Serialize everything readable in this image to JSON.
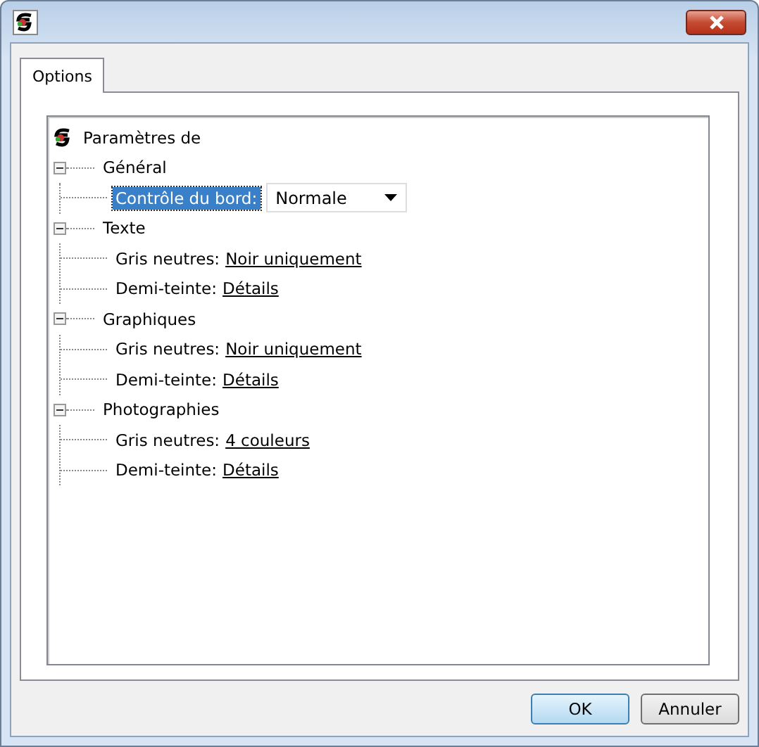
{
  "tabs": [
    {
      "label": "Options",
      "selected": true
    }
  ],
  "tree": {
    "label": "Paramètres de",
    "groups": [
      {
        "label": "Général",
        "expanded": true,
        "items": [
          {
            "kind": "dropdown",
            "label": "Contrôle du bord:",
            "selected": true,
            "value": "Normale"
          }
        ]
      },
      {
        "label": "Texte",
        "expanded": true,
        "items": [
          {
            "kind": "link",
            "label": "Gris neutres:",
            "selected": false,
            "value": "Noir uniquement"
          },
          {
            "kind": "link",
            "label": "Demi-teinte:",
            "selected": false,
            "value": "Détails"
          }
        ]
      },
      {
        "label": "Graphiques",
        "expanded": true,
        "items": [
          {
            "kind": "link",
            "label": "Gris neutres:",
            "selected": false,
            "value": "Noir uniquement"
          },
          {
            "kind": "link",
            "label": "Demi-teinte:",
            "selected": false,
            "value": "Détails"
          }
        ]
      },
      {
        "label": "Photographies",
        "expanded": true,
        "items": [
          {
            "kind": "link",
            "label": "Gris neutres:",
            "selected": false,
            "value": "4 couleurs"
          },
          {
            "kind": "link",
            "label": "Demi-teinte:",
            "selected": false,
            "value": "Détails"
          }
        ]
      }
    ]
  },
  "buttons": [
    {
      "label": "OK",
      "default": true
    },
    {
      "label": "Annuler",
      "default": false
    }
  ]
}
